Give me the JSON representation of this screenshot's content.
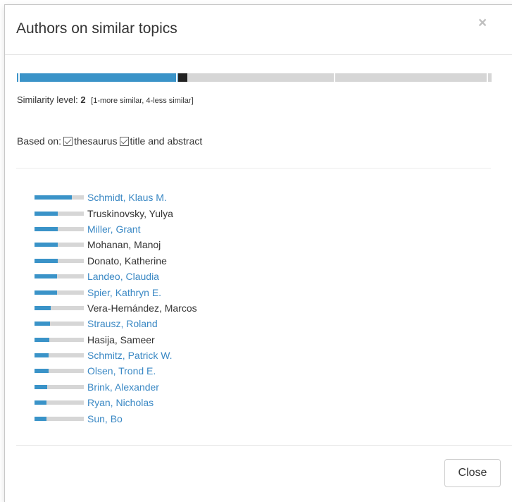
{
  "dialog": {
    "title": "Authors on similar topics",
    "close_symbol": "×"
  },
  "similarity": {
    "label": "Similarity level:",
    "value": "2",
    "hint": "[1-more similar, 4-less similar]",
    "slider_level_fraction": 0.34
  },
  "based_on": {
    "label": "Based on:",
    "options": [
      {
        "label": "thesaurus",
        "checked": true
      },
      {
        "label": "title and abstract",
        "checked": true
      }
    ]
  },
  "authors": [
    {
      "name": "Schmidt, Klaus M.",
      "link": true,
      "score": 0.76
    },
    {
      "name": "Truskinovsky, Yulya",
      "link": false,
      "score": 0.47
    },
    {
      "name": "Miller, Grant",
      "link": true,
      "score": 0.47
    },
    {
      "name": "Mohanan, Manoj",
      "link": false,
      "score": 0.47
    },
    {
      "name": "Donato, Katherine",
      "link": false,
      "score": 0.47
    },
    {
      "name": "Landeo, Claudia",
      "link": true,
      "score": 0.45
    },
    {
      "name": "Spier, Kathryn E.",
      "link": true,
      "score": 0.45
    },
    {
      "name": "Vera-Hernández, Marcos",
      "link": false,
      "score": 0.33
    },
    {
      "name": "Strausz, Roland",
      "link": true,
      "score": 0.31
    },
    {
      "name": "Hasija, Sameer",
      "link": false,
      "score": 0.3
    },
    {
      "name": "Schmitz, Patrick W.",
      "link": true,
      "score": 0.28
    },
    {
      "name": "Olsen, Trond E.",
      "link": true,
      "score": 0.28
    },
    {
      "name": "Brink, Alexander",
      "link": true,
      "score": 0.26
    },
    {
      "name": "Ryan, Nicholas",
      "link": true,
      "score": 0.24
    },
    {
      "name": "Sun, Bo",
      "link": true,
      "score": 0.24
    }
  ],
  "footer": {
    "close_label": "Close"
  },
  "colors": {
    "accent": "#3a93c8",
    "link": "#3a88c4",
    "track": "#d6d6d6"
  }
}
